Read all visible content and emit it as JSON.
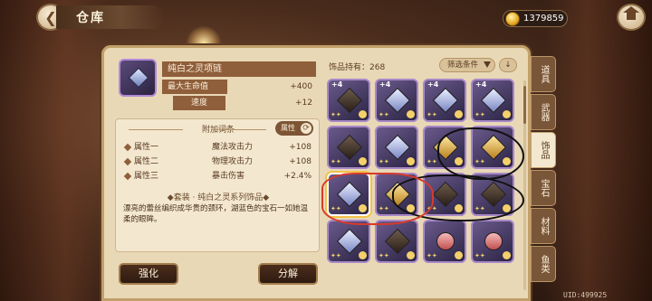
{
  "header": {
    "title": "仓库",
    "currency_amount": "1379859"
  },
  "detail": {
    "item_name": "纯白之灵项链",
    "stats": [
      {
        "label": "最大生命值",
        "value": "+400"
      },
      {
        "label": "速度",
        "value": "+12"
      }
    ],
    "affix_title": "附加词条",
    "attr_button": "属性",
    "affixes": [
      {
        "name": "属性一",
        "stat": "魔法攻击力",
        "value": "+108"
      },
      {
        "name": "属性二",
        "stat": "物理攻击力",
        "value": "+108"
      },
      {
        "name": "属性三",
        "stat": "暴击伤害",
        "value": "+2.4%"
      }
    ],
    "set_title": "◆套装 · 纯白之灵系列饰品◆",
    "set_description": "漂亮的蕾丝编织成华贵的颈环，湖蓝色的宝石一如她温柔的眼眸。",
    "strengthen_label": "强化",
    "decompose_label": "分解"
  },
  "inventory": {
    "count_label": "饰品持有：268",
    "filter_label": "筛选条件",
    "sort_label": "↓",
    "slots": [
      {
        "level": "+4",
        "style": "dark"
      },
      {
        "level": "+4",
        "style": "normal"
      },
      {
        "level": "+4",
        "style": "normal"
      },
      {
        "level": "+4",
        "style": "normal"
      },
      {
        "level": "",
        "style": "dark"
      },
      {
        "level": "",
        "style": "normal"
      },
      {
        "level": "",
        "style": "gold"
      },
      {
        "level": "",
        "style": "gold"
      },
      {
        "level": "",
        "style": "normal",
        "selected": true
      },
      {
        "level": "",
        "style": "gold"
      },
      {
        "level": "",
        "style": "dark"
      },
      {
        "level": "",
        "style": "dark"
      },
      {
        "level": "",
        "style": "normal"
      },
      {
        "level": "",
        "style": "dark"
      },
      {
        "level": "",
        "style": "red"
      },
      {
        "level": "",
        "style": "red"
      }
    ]
  },
  "tabs": [
    "道具",
    "武器",
    "饰品",
    "宝石",
    "材料",
    "鱼类"
  ],
  "active_tab": "饰品",
  "uid": "UID:499925"
}
